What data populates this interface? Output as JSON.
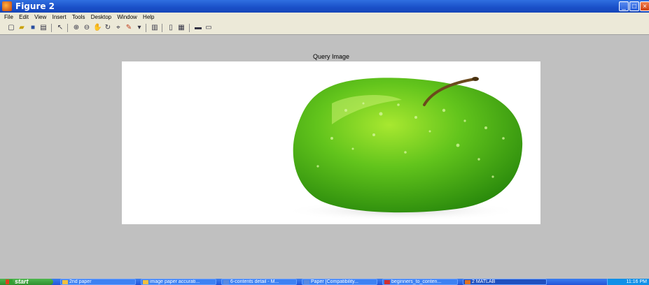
{
  "window": {
    "title": "Figure 2"
  },
  "menu": [
    "File",
    "Edit",
    "View",
    "Insert",
    "Tools",
    "Desktop",
    "Window",
    "Help"
  ],
  "toolbar_icons": [
    "new-figure-icon",
    "open-file-icon",
    "save-icon",
    "print-icon",
    "pointer-icon",
    "zoom-in-icon",
    "zoom-out-icon",
    "pan-icon",
    "rotate-icon",
    "data-cursor-icon",
    "brush-icon",
    "link-icon",
    "colorbar-icon",
    "legend-icon",
    "hide-plot-tools-icon",
    "show-plot-tools-icon"
  ],
  "figure": {
    "axes_title": "Query Image"
  },
  "colors": {
    "apple_green": "#5cc420",
    "apple_dark": "#2f8f10",
    "stem": "#6b4a1c",
    "titlebar": "#1a4fc8",
    "taskbar": "#2456d8"
  },
  "taskbar": {
    "start_label": "start",
    "items": [
      {
        "label": "2nd paper",
        "active": false
      },
      {
        "label": "image paper accurati...",
        "active": false
      },
      {
        "label": "6-contents detail - M...",
        "active": false
      },
      {
        "label": "Paper [Compatibility...",
        "active": false
      },
      {
        "label": "beginners_to_conten...",
        "active": false
      },
      {
        "label": "2 MATLAB",
        "active": true
      }
    ],
    "clock": "11:16 PM"
  }
}
